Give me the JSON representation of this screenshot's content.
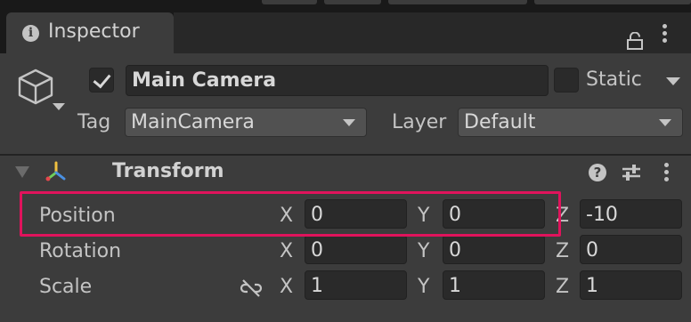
{
  "tab": {
    "icon": "info-icon",
    "title": "Inspector"
  },
  "window": {
    "lock_icon": "lock-icon",
    "menu_icon": "kebab-menu-icon"
  },
  "gameobject": {
    "icon": "cube-icon",
    "active": true,
    "name": "Main Camera",
    "static_checked": false,
    "static_label": "Static",
    "tag_label": "Tag",
    "tag_value": "MainCamera",
    "layer_label": "Layer",
    "layer_value": "Default"
  },
  "component": {
    "title": "Transform",
    "expanded": true,
    "icon": "transform-axes-icon",
    "help_icon": "help-icon",
    "presets_icon": "sliders-icon",
    "menu_icon": "kebab-menu-icon",
    "rows": [
      {
        "label": "Position",
        "x_label": "X",
        "x": "0",
        "y_label": "Y",
        "y": "0",
        "z_label": "Z",
        "z": "-10"
      },
      {
        "label": "Rotation",
        "x_label": "X",
        "x": "0",
        "y_label": "Y",
        "y": "0",
        "z_label": "Z",
        "z": "0"
      },
      {
        "label": "Scale",
        "x_label": "X",
        "x": "1",
        "y_label": "Y",
        "y": "1",
        "z_label": "Z",
        "z": "1",
        "constrain_icon": "link-broken-icon"
      }
    ]
  },
  "colors": {
    "panel_bg": "#3c3c3c",
    "field_bg": "#2a2a2a",
    "dropdown_bg": "#515151",
    "text": "#c4c4c4",
    "highlight": "#e0135c",
    "axis_x": "#e5484d",
    "axis_y": "#6fcf5a",
    "axis_z": "#4a90e2",
    "axis_w": "#f0c040"
  }
}
